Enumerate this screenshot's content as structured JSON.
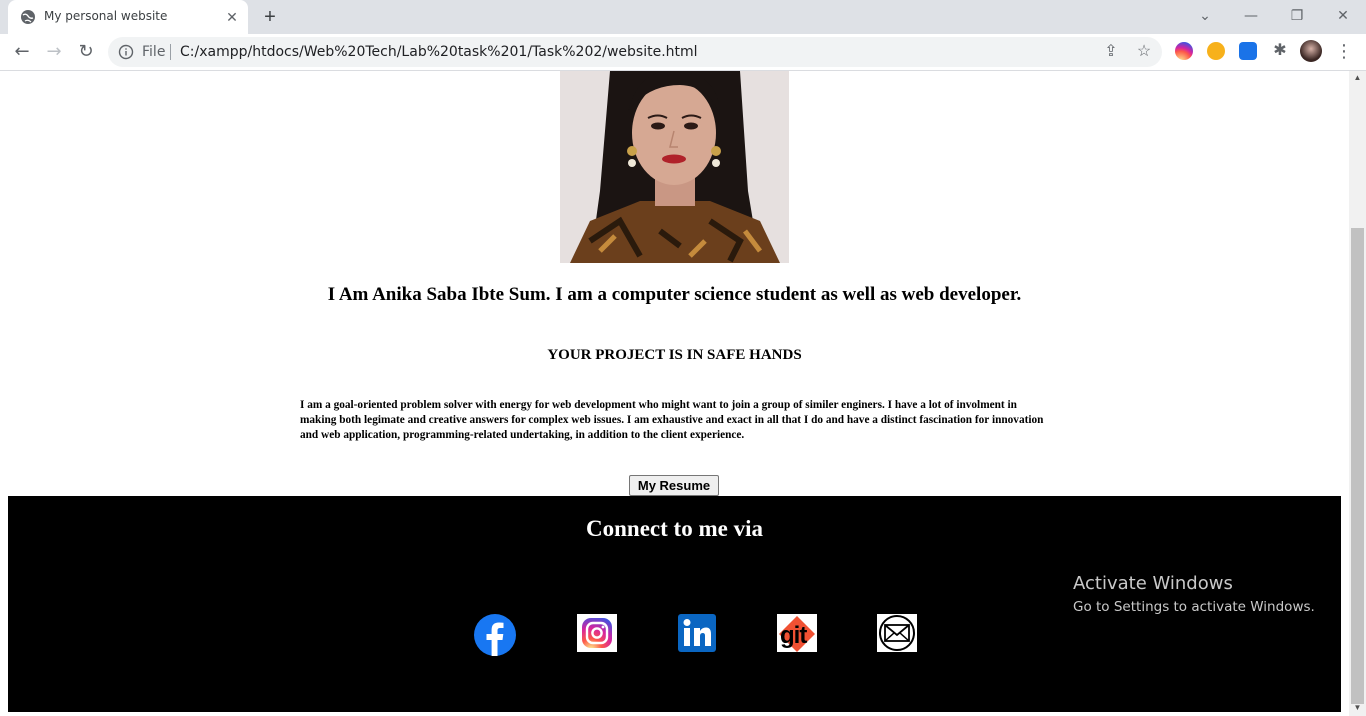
{
  "browser": {
    "tab_title": "My personal website",
    "new_tab": "+",
    "close_tab": "✕",
    "file_label": "File",
    "url": "C:/xampp/htdocs/Web%20Tech/Lab%20task%201/Task%202/website.html"
  },
  "page": {
    "headline": "I Am Anika Saba Ibte Sum. I am a computer science student as well as web developer.",
    "subhead": "YOUR PROJECT IS IN SAFE HANDS",
    "bio": "I am a goal-oriented problem solver with energy for web development who might want to join a group of similer enginers. I have a lot of involment in making both legimate and creative answers for complex web issues. I am exhaustive and exact in all that I do and have a distinct fascination for innovation and web application, programming-related undertaking, in addition to the client experience.",
    "resume_button": "My Resume",
    "footer_title": "Connect to me via",
    "social": [
      "facebook",
      "instagram",
      "linkedin",
      "git",
      "email"
    ],
    "git_label": "git"
  },
  "watermark": {
    "title": "Activate Windows",
    "subtitle": "Go to Settings to activate Windows."
  }
}
